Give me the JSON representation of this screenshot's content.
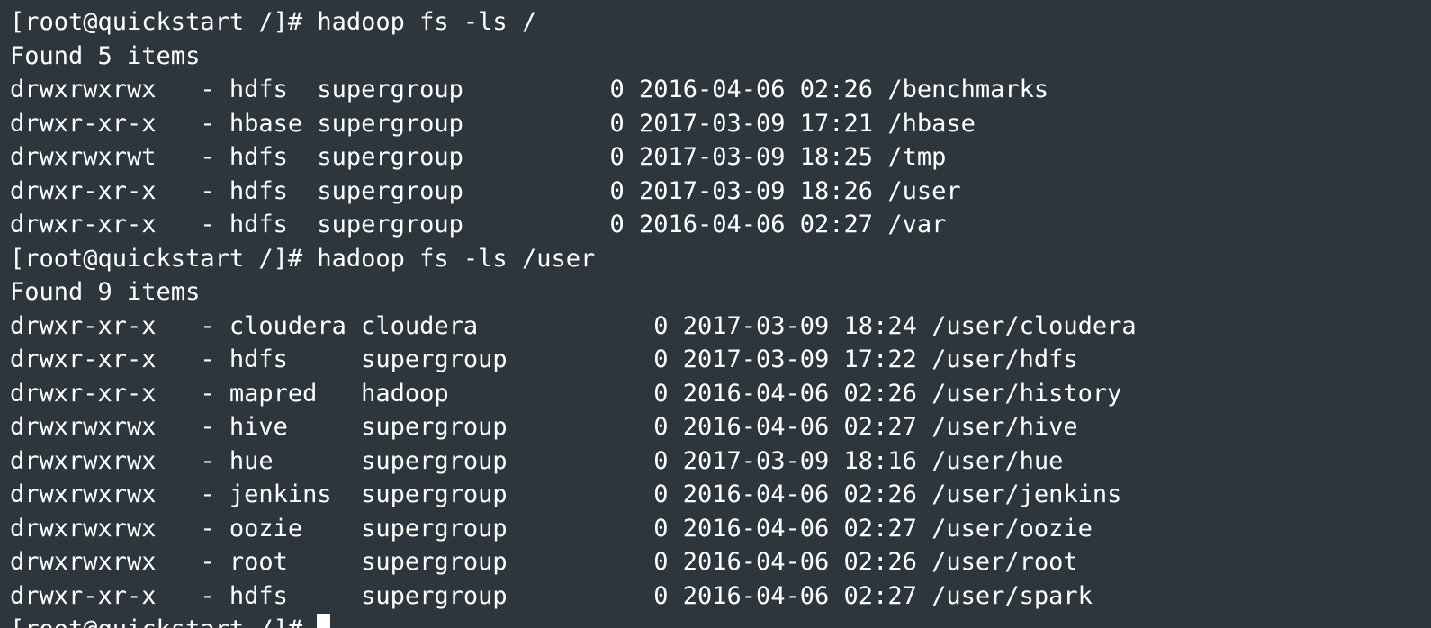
{
  "colors": {
    "background": "#2c363c",
    "foreground": "#ffffff"
  },
  "lines": [
    "[root@quickstart /]# hadoop fs -ls /",
    "Found 5 items",
    "drwxrwxrwx   - hdfs  supergroup          0 2016-04-06 02:26 /benchmarks",
    "drwxr-xr-x   - hbase supergroup          0 2017-03-09 17:21 /hbase",
    "drwxrwxrwt   - hdfs  supergroup          0 2017-03-09 18:25 /tmp",
    "drwxr-xr-x   - hdfs  supergroup          0 2017-03-09 18:26 /user",
    "drwxr-xr-x   - hdfs  supergroup          0 2016-04-06 02:27 /var",
    "[root@quickstart /]# hadoop fs -ls /user",
    "Found 9 items",
    "drwxr-xr-x   - cloudera cloudera            0 2017-03-09 18:24 /user/cloudera",
    "drwxr-xr-x   - hdfs     supergroup          0 2017-03-09 17:22 /user/hdfs",
    "drwxr-xr-x   - mapred   hadoop              0 2016-04-06 02:26 /user/history",
    "drwxrwxrwx   - hive     supergroup          0 2016-04-06 02:27 /user/hive",
    "drwxrwxrwx   - hue      supergroup          0 2017-03-09 18:16 /user/hue",
    "drwxrwxrwx   - jenkins  supergroup          0 2016-04-06 02:26 /user/jenkins",
    "drwxrwxrwx   - oozie    supergroup          0 2016-04-06 02:27 /user/oozie",
    "drwxrwxrwx   - root     supergroup          0 2016-04-06 02:26 /user/root",
    "drwxr-xr-x   - hdfs     supergroup          0 2016-04-06 02:27 /user/spark"
  ],
  "prompt": "[root@quickstart /]# "
}
